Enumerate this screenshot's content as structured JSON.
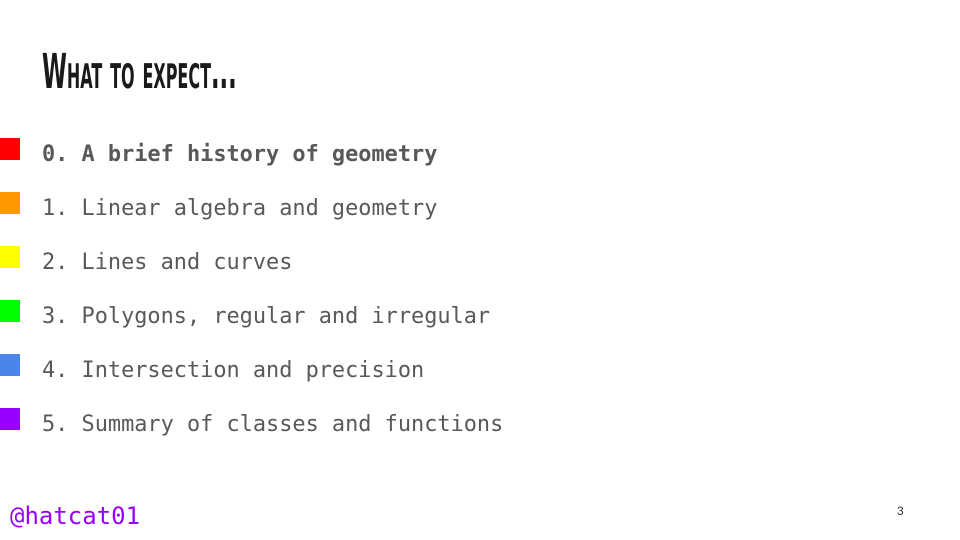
{
  "slide": {
    "title": "What to expect...",
    "items": [
      {
        "label": "0. A brief history of geometry",
        "color": "#ff0000",
        "active": true
      },
      {
        "label": "1. Linear algebra and geometry",
        "color": "#ff9900",
        "active": false
      },
      {
        "label": "2. Lines and curves",
        "color": "#ffff00",
        "active": false
      },
      {
        "label": "3. Polygons, regular and irregular",
        "color": "#00ff00",
        "active": false
      },
      {
        "label": "4. Intersection and precision",
        "color": "#4a86e8",
        "active": false
      },
      {
        "label": "5. Summary of classes and functions",
        "color": "#9900ff",
        "active": false
      }
    ],
    "handle": "@hatcat01",
    "page_number": "3"
  }
}
